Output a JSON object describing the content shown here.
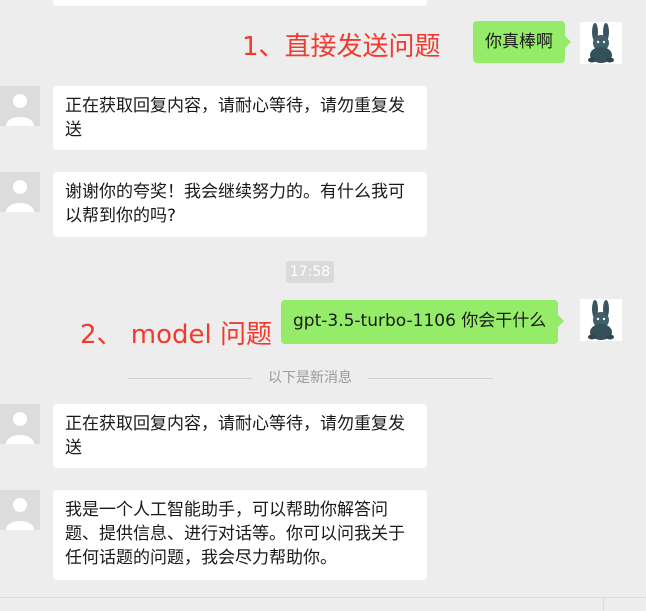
{
  "messages": {
    "m1_user": "你真棒啊",
    "m2_bot": "正在获取回复内容，请耐心等待，请勿重复发送",
    "m3_bot": "谢谢你的夸奖！我会继续努力的。有什么我可以帮到你的吗?",
    "m4_user": "gpt-3.5-turbo-1106  你会干什么",
    "m5_bot": "正在获取回复内容，请耐心等待，请勿重复发送",
    "m6_bot": "我是一个人工智能助手，可以帮助你解答问题、提供信息、进行对话等。你可以问我关于任何话题的问题，我会尽力帮助你。"
  },
  "annotations": {
    "first": "1、直接发送问题",
    "second": "2、 model  问题"
  },
  "timestamp": "17:58",
  "divider": "以下是新消息",
  "colors": {
    "chat_bg": "#ededed",
    "user_bubble": "#95ec69",
    "bot_bubble": "#ffffff",
    "annotation_red": "#f03a2e"
  },
  "icons": {
    "bot_avatar": "default-person-avatar-icon",
    "user_avatar": "rabbit-plush-avatar-icon"
  }
}
